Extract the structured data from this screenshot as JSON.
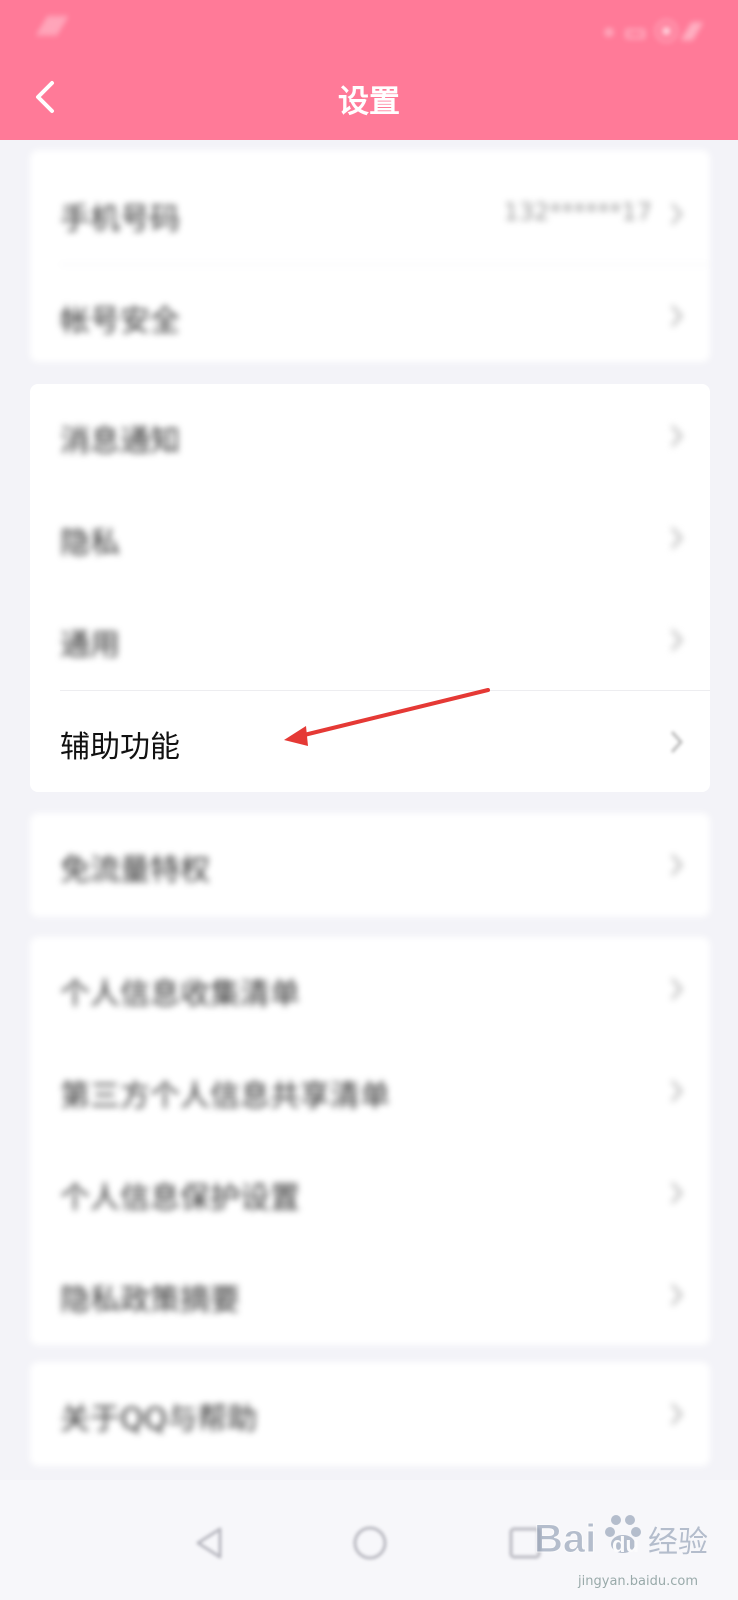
{
  "status_bar": {
    "left_text": "⁄⁄⁄⁄",
    "right_text": "∘ ▭ ⦿ ⁄⁄⁄"
  },
  "header": {
    "title": "设置",
    "accent_color": "#ff7a98"
  },
  "groups": [
    {
      "items": [
        {
          "label": "手机号码",
          "value": "132******17"
        },
        {
          "label": "帐号安全"
        }
      ]
    },
    {
      "items": [
        {
          "label": "消息通知"
        },
        {
          "label": "隐私"
        },
        {
          "label": "通用"
        },
        {
          "label": "辅助功能"
        }
      ]
    },
    {
      "items": [
        {
          "label": "免流量特权"
        }
      ]
    },
    {
      "items": [
        {
          "label": "个人信息收集清单"
        },
        {
          "label": "第三方个人信息共享清单"
        },
        {
          "label": "个人信息保护设置"
        },
        {
          "label": "隐私政策摘要"
        }
      ]
    },
    {
      "items": [
        {
          "label": "关于QQ与帮助"
        }
      ]
    }
  ],
  "annotation": {
    "highlighted_item": "辅助功能",
    "arrow_color": "#e53935"
  },
  "watermark": {
    "brand": "Bai",
    "brand2": "du",
    "brand_cn": "经验",
    "url": "jingyan.baidu.com"
  }
}
